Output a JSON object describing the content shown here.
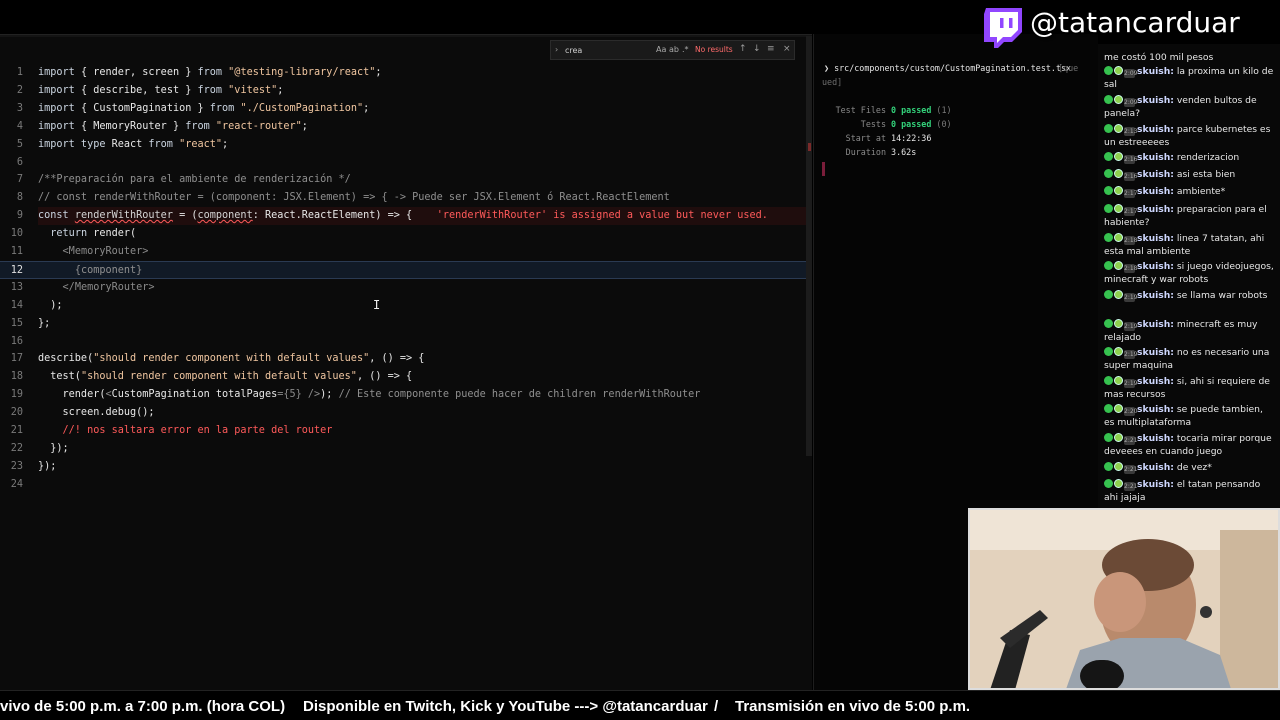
{
  "find": {
    "query": "crea",
    "options": [
      "Aa",
      "ab",
      ".*"
    ],
    "result": "No results"
  },
  "editor": {
    "lines": [
      {
        "n": "1",
        "parts": [
          [
            "kw",
            "import"
          ],
          [
            "pl",
            " { render, screen } "
          ],
          [
            "kw",
            "from"
          ],
          [
            "pl",
            " "
          ],
          [
            "str",
            "\"@testing-library/react\""
          ],
          [
            "pl",
            ";"
          ]
        ]
      },
      {
        "n": "2",
        "parts": [
          [
            "kw",
            "import"
          ],
          [
            "pl",
            " { describe, test } "
          ],
          [
            "kw",
            "from"
          ],
          [
            "pl",
            " "
          ],
          [
            "str",
            "\"vitest\""
          ],
          [
            "pl",
            ";"
          ]
        ]
      },
      {
        "n": "3",
        "parts": [
          [
            "kw",
            "import"
          ],
          [
            "pl",
            " { CustomPagination } "
          ],
          [
            "kw",
            "from"
          ],
          [
            "pl",
            " "
          ],
          [
            "str",
            "\"./CustomPagination\""
          ],
          [
            "pl",
            ";"
          ]
        ]
      },
      {
        "n": "4",
        "parts": [
          [
            "kw",
            "import"
          ],
          [
            "pl",
            " { MemoryRouter } "
          ],
          [
            "kw",
            "from"
          ],
          [
            "pl",
            " "
          ],
          [
            "str",
            "\"react-router\""
          ],
          [
            "pl",
            ";"
          ]
        ]
      },
      {
        "n": "5",
        "parts": [
          [
            "kw",
            "import type"
          ],
          [
            "pl",
            " React "
          ],
          [
            "kw",
            "from"
          ],
          [
            "pl",
            " "
          ],
          [
            "str",
            "\"react\""
          ],
          [
            "pl",
            ";"
          ]
        ]
      },
      {
        "n": "6",
        "parts": []
      },
      {
        "n": "7",
        "parts": [
          [
            "cm",
            "/**Preparación para el ambiente de renderización */"
          ]
        ]
      },
      {
        "n": "8",
        "parts": [
          [
            "cm",
            "// const renderWithRouter = (component: JSX.Element) => { -> Puede ser JSX.Element ó React.ReactElement"
          ]
        ]
      },
      {
        "n": "9",
        "parts": [
          [
            "kw",
            "const"
          ],
          [
            "pl",
            " "
          ],
          [
            "squig",
            "renderWithRouter"
          ],
          [
            "pl",
            " = ("
          ],
          [
            "squig",
            "component"
          ],
          [
            "pl",
            ": React.ReactElement) => {    "
          ],
          [
            "err",
            "'renderWithRouter' is assigned a value but never used."
          ]
        ]
      },
      {
        "n": "10",
        "parts": [
          [
            "pl",
            "  "
          ],
          [
            "kw",
            "return"
          ],
          [
            "pl",
            " render("
          ]
        ]
      },
      {
        "n": "11",
        "parts": [
          [
            "pl",
            "    "
          ],
          [
            "tag",
            "<MemoryRouter>"
          ]
        ]
      },
      {
        "n": "12",
        "parts": [
          [
            "pl",
            "      "
          ],
          [
            "cm",
            "{component}"
          ]
        ]
      },
      {
        "n": "13",
        "parts": [
          [
            "pl",
            "    "
          ],
          [
            "tag",
            "</MemoryRouter>"
          ]
        ]
      },
      {
        "n": "14",
        "parts": [
          [
            "pl",
            "  );"
          ]
        ]
      },
      {
        "n": "15",
        "parts": [
          [
            "pl",
            "};"
          ]
        ]
      },
      {
        "n": "16",
        "parts": []
      },
      {
        "n": "17",
        "parts": [
          [
            "pl",
            "describe("
          ],
          [
            "str",
            "\"should render component with default values\""
          ],
          [
            "pl",
            ", () => {"
          ]
        ]
      },
      {
        "n": "18",
        "parts": [
          [
            "pl",
            "  test("
          ],
          [
            "str",
            "\"should render component with default values\""
          ],
          [
            "pl",
            ", () => {"
          ]
        ]
      },
      {
        "n": "19",
        "parts": [
          [
            "pl",
            "    render("
          ],
          [
            "tag",
            "<"
          ],
          [
            "pl",
            "CustomPagination totalPages"
          ],
          [
            "tag",
            "={5} />"
          ],
          [
            "pl",
            "); "
          ],
          [
            "cm",
            "// Este componente puede hacer de children renderWithRouter"
          ]
        ]
      },
      {
        "n": "20",
        "parts": [
          [
            "pl",
            "    screen.debug();"
          ]
        ]
      },
      {
        "n": "21",
        "parts": [
          [
            "err",
            "    //! nos saltara error en la parte del router"
          ]
        ]
      },
      {
        "n": "22",
        "parts": [
          [
            "pl",
            "  });"
          ]
        ]
      },
      {
        "n": "23",
        "parts": [
          [
            "pl",
            "});"
          ]
        ]
      },
      {
        "n": "24",
        "parts": []
      }
    ]
  },
  "terminal": {
    "path": "❯ src/components/custom/CustomPagination.test.tsx",
    "queued_a": "[que",
    "queued_b": "ued]",
    "rows": [
      {
        "label": "Test Files",
        "pass": "0 passed",
        "rest": " (1)"
      },
      {
        "label": "Tests",
        "pass": "0 passed",
        "rest": " (0)"
      },
      {
        "label": "Start at",
        "value": "14:22:36"
      },
      {
        "label": "Duration",
        "value": "3.62s"
      }
    ]
  },
  "twitch": {
    "handle": "@tatancarduar",
    "logo": "twitch-logo-icon",
    "color": "#9146ff"
  },
  "chat": [
    {
      "time": "",
      "user": "",
      "text": "me costó 100 mil pesos"
    },
    {
      "time": "2:09",
      "user": "skuish:",
      "text": "la proxima un kilo de sal"
    },
    {
      "time": "2:09",
      "user": "skuish:",
      "text": "venden bultos de panela?"
    },
    {
      "time": "2:13",
      "user": "skuish:",
      "text": "parce kubernetes es un estreeeees"
    },
    {
      "time": "2:16",
      "user": "skuish:",
      "text": "renderizacion"
    },
    {
      "time": "2:16",
      "user": "skuish:",
      "text": "asi esta bien"
    },
    {
      "time": "2:17",
      "user": "skuish:",
      "text": "ambiente*"
    },
    {
      "time": "2:17",
      "user": "skuish:",
      "text": "preparacion para el habiente?"
    },
    {
      "time": "2:18",
      "user": "skuish:",
      "text": "linea 7 tatatan, ahi esta mal ambiente"
    },
    {
      "time": "2:18",
      "user": "skuish:",
      "text": "si juego videojuegos, minecraft y war robots"
    },
    {
      "time": "2:19",
      "user": "skuish:",
      "text": "se llama war robots"
    },
    {
      "time": "2:19",
      "user": "skuish:",
      "text": "minecraft es muy relajado"
    },
    {
      "time": "2:19",
      "user": "skuish:",
      "text": "no es necesario una super maquina"
    },
    {
      "time": "2:19",
      "user": "skuish:",
      "text": "si, ahi si requiere de mas recursos"
    },
    {
      "time": "2:20",
      "user": "skuish:",
      "text": "se puede tambien, es multiplataforma"
    },
    {
      "time": "2:21",
      "user": "skuish:",
      "text": "tocaria mirar porque deveees en cuando juego"
    },
    {
      "time": "2:21",
      "user": "skuish:",
      "text": "de vez*"
    },
    {
      "time": "2:21",
      "user": "skuish:",
      "text": "el tatan pensando ahi jajaja"
    }
  ],
  "ticker": {
    "seg1": "vivo de 5:00 p.m. a 7:00 p.m. (hora COL)",
    "seg2": "Disponible en Twitch, Kick y YouTube ---> @tatancarduar",
    "sep": "/",
    "seg3": "Transmisión en vivo de 5:00 p.m."
  }
}
